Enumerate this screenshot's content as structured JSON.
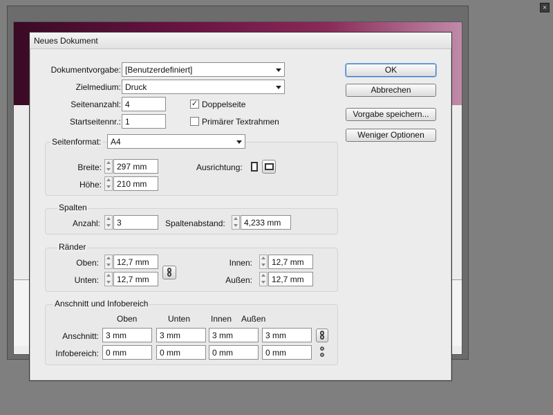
{
  "dialog": {
    "title": "Neues Dokument"
  },
  "preset": {
    "label": "Dokumentvorgabe:",
    "value": "[Benutzerdefiniert]"
  },
  "intent": {
    "label": "Zielmedium:",
    "value": "Druck"
  },
  "pages": {
    "label": "Seitenanzahl:",
    "value": "4"
  },
  "start_page": {
    "label": "Startseitennr.:",
    "value": "1"
  },
  "facing_pages": {
    "label": "Doppelseite",
    "checked": true
  },
  "master_text_frame": {
    "label": "Primärer Textrahmen",
    "checked": false
  },
  "page_size": {
    "label": "Seitenformat:",
    "value": "A4",
    "width_label": "Breite:",
    "width": "297 mm",
    "height_label": "Höhe:",
    "height": "210 mm",
    "orientation_label": "Ausrichtung:"
  },
  "columns": {
    "title": "Spalten",
    "count_label": "Anzahl:",
    "count": "3",
    "gutter_label": "Spaltenabstand:",
    "gutter": "4,233 mm"
  },
  "margins": {
    "title": "Ränder",
    "top_label": "Oben:",
    "top": "12,7 mm",
    "bottom_label": "Unten:",
    "bottom": "12,7 mm",
    "inside_label": "Innen:",
    "inside": "12,7 mm",
    "outside_label": "Außen:",
    "outside": "12,7 mm"
  },
  "bleed_slug": {
    "title": "Anschnitt und Infobereich",
    "columns": [
      "Oben",
      "Unten",
      "Innen",
      "Außen"
    ],
    "bleed_label": "Anschnitt:",
    "bleed": [
      "3 mm",
      "3 mm",
      "3 mm",
      "3 mm"
    ],
    "slug_label": "Infobereich:",
    "slug": [
      "0 mm",
      "0 mm",
      "0 mm",
      "0 mm"
    ]
  },
  "buttons": {
    "ok": "OK",
    "cancel": "Abbrechen",
    "save_preset": "Vorgabe speichern...",
    "fewer_options": "Weniger Optionen"
  },
  "background_window": {
    "close_glyph": "×"
  },
  "colors": {
    "banner": "#6b1444",
    "default_button_border": "#3a78c8"
  }
}
